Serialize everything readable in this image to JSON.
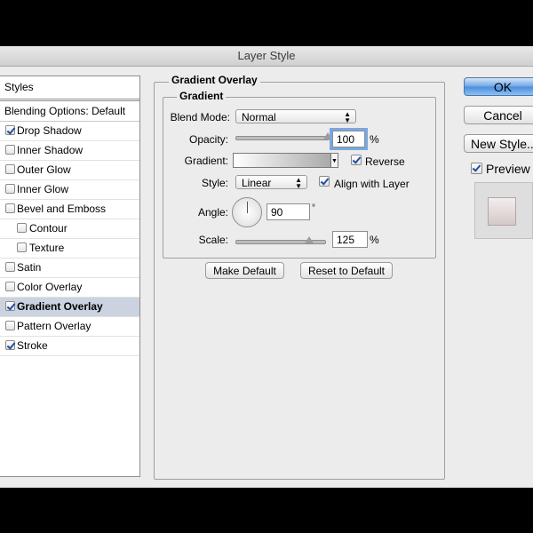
{
  "window": {
    "title": "Layer Style"
  },
  "styles_panel": {
    "header": "Styles",
    "blending_options": "Blending Options: Default",
    "items": [
      {
        "label": "Drop Shadow",
        "checked": true
      },
      {
        "label": "Inner Shadow",
        "checked": false
      },
      {
        "label": "Outer Glow",
        "checked": false
      },
      {
        "label": "Inner Glow",
        "checked": false
      },
      {
        "label": "Bevel and Emboss",
        "checked": false
      },
      {
        "label": "Contour",
        "checked": false
      },
      {
        "label": "Texture",
        "checked": false
      },
      {
        "label": "Satin",
        "checked": false
      },
      {
        "label": "Color Overlay",
        "checked": false
      },
      {
        "label": "Gradient Overlay",
        "checked": true,
        "selected": true
      },
      {
        "label": "Pattern Overlay",
        "checked": false
      },
      {
        "label": "Stroke",
        "checked": true
      }
    ]
  },
  "gradient_overlay": {
    "section_title": "Gradient Overlay",
    "group_title": "Gradient",
    "blend_mode_label": "Blend Mode:",
    "blend_mode_value": "Normal",
    "opacity_label": "Opacity:",
    "opacity_value": "100",
    "opacity_unit": "%",
    "opacity_level": 1.0,
    "gradient_label": "Gradient:",
    "gradient_colors": [
      "#ffffff",
      "#a9a9a9"
    ],
    "reverse_label": "Reverse",
    "reverse_checked": true,
    "style_label": "Style:",
    "style_value": "Linear",
    "align_label": "Align with Layer",
    "align_checked": true,
    "angle_label": "Angle:",
    "angle_value": "90",
    "angle_unit": "°",
    "scale_label": "Scale:",
    "scale_value": "125",
    "scale_unit": "%",
    "scale_level": 0.83,
    "make_default": "Make Default",
    "reset_default": "Reset to Default"
  },
  "actions": {
    "ok": "OK",
    "cancel": "Cancel",
    "new_style": "New Style...",
    "preview_label": "Preview",
    "preview_checked": true
  },
  "colors": {
    "primary_button": "#4c8ddc",
    "selected_row": "#cbd3e0",
    "focus_ring": "#7aa7e0"
  }
}
